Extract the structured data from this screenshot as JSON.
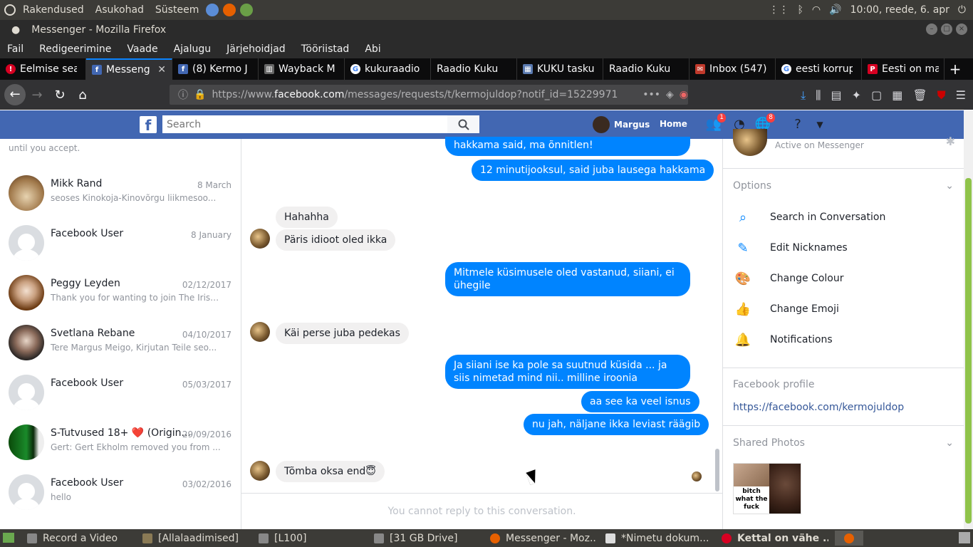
{
  "os_panel": {
    "menus": [
      "Rakendused",
      "Asukohad",
      "Süsteem"
    ],
    "clock": "10:00, reede, 6. apr"
  },
  "window": {
    "title": "Messenger - Mozilla Firefox"
  },
  "menubar": [
    "Fail",
    "Redigeerimine",
    "Vaade",
    "Ajalugu",
    "Järjehoidjad",
    "Tööriistad",
    "Abi"
  ],
  "tabs": [
    {
      "label": "Eelmise sea",
      "icon": "alert-icon",
      "color": "#d70022"
    },
    {
      "label": "Messenger",
      "icon": "facebook-icon",
      "color": "#4267b2",
      "active": true
    },
    {
      "label": "(8) Kermo J",
      "icon": "facebook-icon",
      "color": "#4267b2"
    },
    {
      "label": "Wayback M",
      "icon": "archive-icon",
      "color": "#888888"
    },
    {
      "label": "kukuraadio",
      "icon": "google-icon",
      "color": "#4285f4"
    },
    {
      "label": "Raadio Kuku",
      "icon": "",
      "color": ""
    },
    {
      "label": "KUKU tasku",
      "icon": "kuku-icon",
      "color": "#5a7ab0"
    },
    {
      "label": "Raadio Kuku",
      "icon": "",
      "color": ""
    },
    {
      "label": "Inbox (547)",
      "icon": "mail-icon",
      "color": "#c0392b"
    },
    {
      "label": "eesti korrup",
      "icon": "google-icon",
      "color": "#4285f4"
    },
    {
      "label": "Eesti on ma",
      "icon": "postimees-icon",
      "color": "#d70022"
    }
  ],
  "nav": {
    "url_prefix": "https://www.",
    "url_domain": "facebook.com",
    "url_rest": "/messages/requests/t/kermojuldop?notif_id=15229971"
  },
  "fb": {
    "search_placeholder": "Search",
    "user_name": "Margus",
    "home": "Home",
    "friend_badge": "1",
    "notif_badge": "8"
  },
  "left": {
    "note": "until you accept.",
    "conversations": [
      {
        "name": "Mikk Rand",
        "date": "8 March",
        "snippet": "seoses Kinokoja-Kinovõrgu liikmesoo..."
      },
      {
        "name": "Facebook User",
        "date": "8 January",
        "snippet": ""
      },
      {
        "name": "Peggy Leyden",
        "date": "02/12/2017",
        "snippet": "Thank you for wanting to join The Irish..."
      },
      {
        "name": "Svetlana Rebane",
        "date": "04/10/2017",
        "snippet": "Tere Margus Meigo, Kirjutan Teile seo..."
      },
      {
        "name": "Facebook User",
        "date": "05/03/2017",
        "snippet": ""
      },
      {
        "name": "S-Tutvused 18+ ❤️ (Origin...",
        "date": "29/09/2016",
        "snippet": "Gert: Gert Ekholm removed you from ..."
      },
      {
        "name": "Facebook User",
        "date": "03/02/2016",
        "snippet": "hello"
      }
    ]
  },
  "messages": [
    {
      "dir": "out",
      "text": "hakkama said, ma õnnitlen!"
    },
    {
      "dir": "out",
      "text": "12 minutijooksul, said juba lausega hakkama"
    },
    {
      "dir": "in",
      "text": "Hahahha"
    },
    {
      "dir": "in",
      "text": "Päris idioot oled ikka"
    },
    {
      "dir": "out",
      "text": "Mitmele küsimusele oled vastanud, siiani, ei ühegile"
    },
    {
      "dir": "in",
      "text": "Käi perse juba pedekas"
    },
    {
      "dir": "out",
      "text": "Ja siiani ise ka pole sa suutnud küsida ... ja siis nimetad mind nii.. milline iroonia"
    },
    {
      "dir": "out",
      "text": "aa see ka veel isnus"
    },
    {
      "dir": "out",
      "text": "nu jah, näljane ikka leviast räägib"
    },
    {
      "dir": "in",
      "text": "Tõmba oksa end😇"
    }
  ],
  "reply_disabled": "You cannot reply to this conversation.",
  "right": {
    "active_status": "Active on Messenger",
    "options_title": "Options",
    "options": [
      {
        "label": "Search in Conversation",
        "icon": "search-icon"
      },
      {
        "label": "Edit Nicknames",
        "icon": "pencil-icon"
      },
      {
        "label": "Change Colour",
        "icon": "palette-icon"
      },
      {
        "label": "Change Emoji",
        "icon": "thumbs-up-icon"
      },
      {
        "label": "Notifications",
        "icon": "bell-icon"
      }
    ],
    "profile_title": "Facebook profile",
    "profile_link": "https://facebook.com/kermojuldop",
    "shared_photos_title": "Shared Photos",
    "photo_caption": "bitch what the fuck"
  },
  "taskbar": [
    {
      "label": "Record a Video"
    },
    {
      "label": "[Allalaadimised]"
    },
    {
      "label": "[L100]"
    },
    {
      "label": "[31 GB Drive]"
    },
    {
      "label": "Messenger - Moz..."
    },
    {
      "label": "*Nimetu dokum..."
    },
    {
      "label": "Kettal on vähe ..."
    }
  ]
}
